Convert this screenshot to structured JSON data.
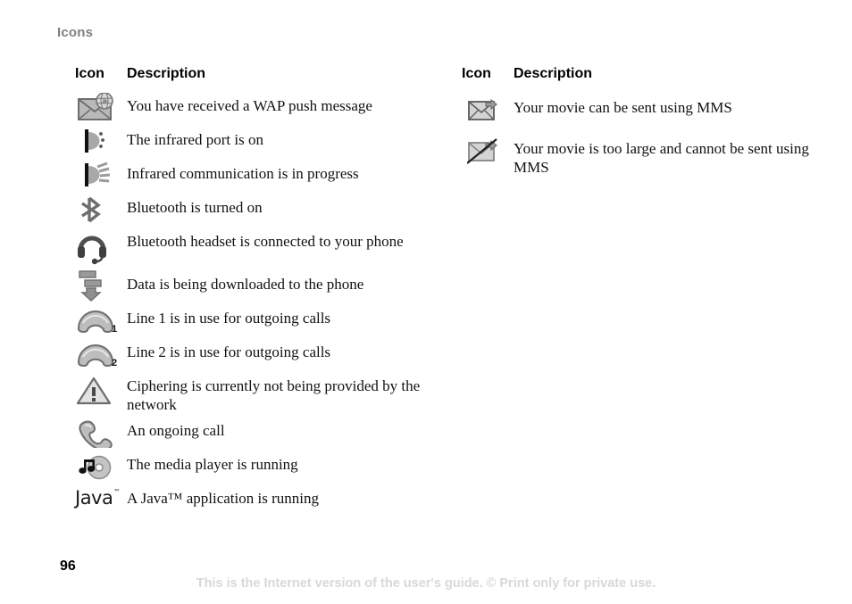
{
  "document": {
    "section_heading": "Icons",
    "page_number": "96",
    "footer_note": "This is the Internet version of the user's guide. © Print only for private use."
  },
  "colors": {
    "heading_gray": "#808080",
    "body_text": "#111111",
    "footer_gray": "#d8d8d8",
    "icon_gray_dark": "#6e6e6e",
    "icon_gray_mid": "#9a9a9a",
    "icon_gray_light": "#c9c9c9",
    "icon_black": "#1a1a1a"
  },
  "columns": {
    "left": {
      "header_icon": "Icon",
      "header_description": "Description",
      "rows": [
        {
          "icon": "wap-push-envelope-globe-icon",
          "description": "You have received a WAP push message"
        },
        {
          "icon": "infrared-port-on-icon",
          "description": "The infrared port is on"
        },
        {
          "icon": "infrared-communication-icon",
          "description": "Infrared communication is in progress"
        },
        {
          "icon": "bluetooth-icon",
          "description": "Bluetooth is turned on"
        },
        {
          "icon": "bluetooth-headset-icon",
          "description": "Bluetooth headset is connected to your phone"
        },
        {
          "icon": "data-download-icon",
          "description": "Data is being downloaded to the phone"
        },
        {
          "icon": "line-1-handset-icon",
          "subscript": "1",
          "description": "Line 1 is in use for outgoing calls"
        },
        {
          "icon": "line-2-handset-icon",
          "subscript": "2",
          "description": "Line 2 is in use for outgoing calls"
        },
        {
          "icon": "ciphering-warning-icon",
          "description": "Ciphering is currently not being provided by the network"
        },
        {
          "icon": "ongoing-call-handset-icon",
          "description": "An ongoing call"
        },
        {
          "icon": "media-player-icon",
          "description": "The media player is running"
        },
        {
          "icon": "java-logo-icon",
          "logo_text": "Java",
          "logo_tm": "™",
          "description": "A Java™ application is running"
        }
      ]
    },
    "right": {
      "header_icon": "Icon",
      "header_description": "Description",
      "rows": [
        {
          "icon": "mms-send-ok-envelope-icon",
          "description": "Your movie can be sent using MMS"
        },
        {
          "icon": "mms-send-blocked-envelope-icon",
          "description": "Your movie is too large and cannot be sent using MMS"
        }
      ]
    }
  }
}
